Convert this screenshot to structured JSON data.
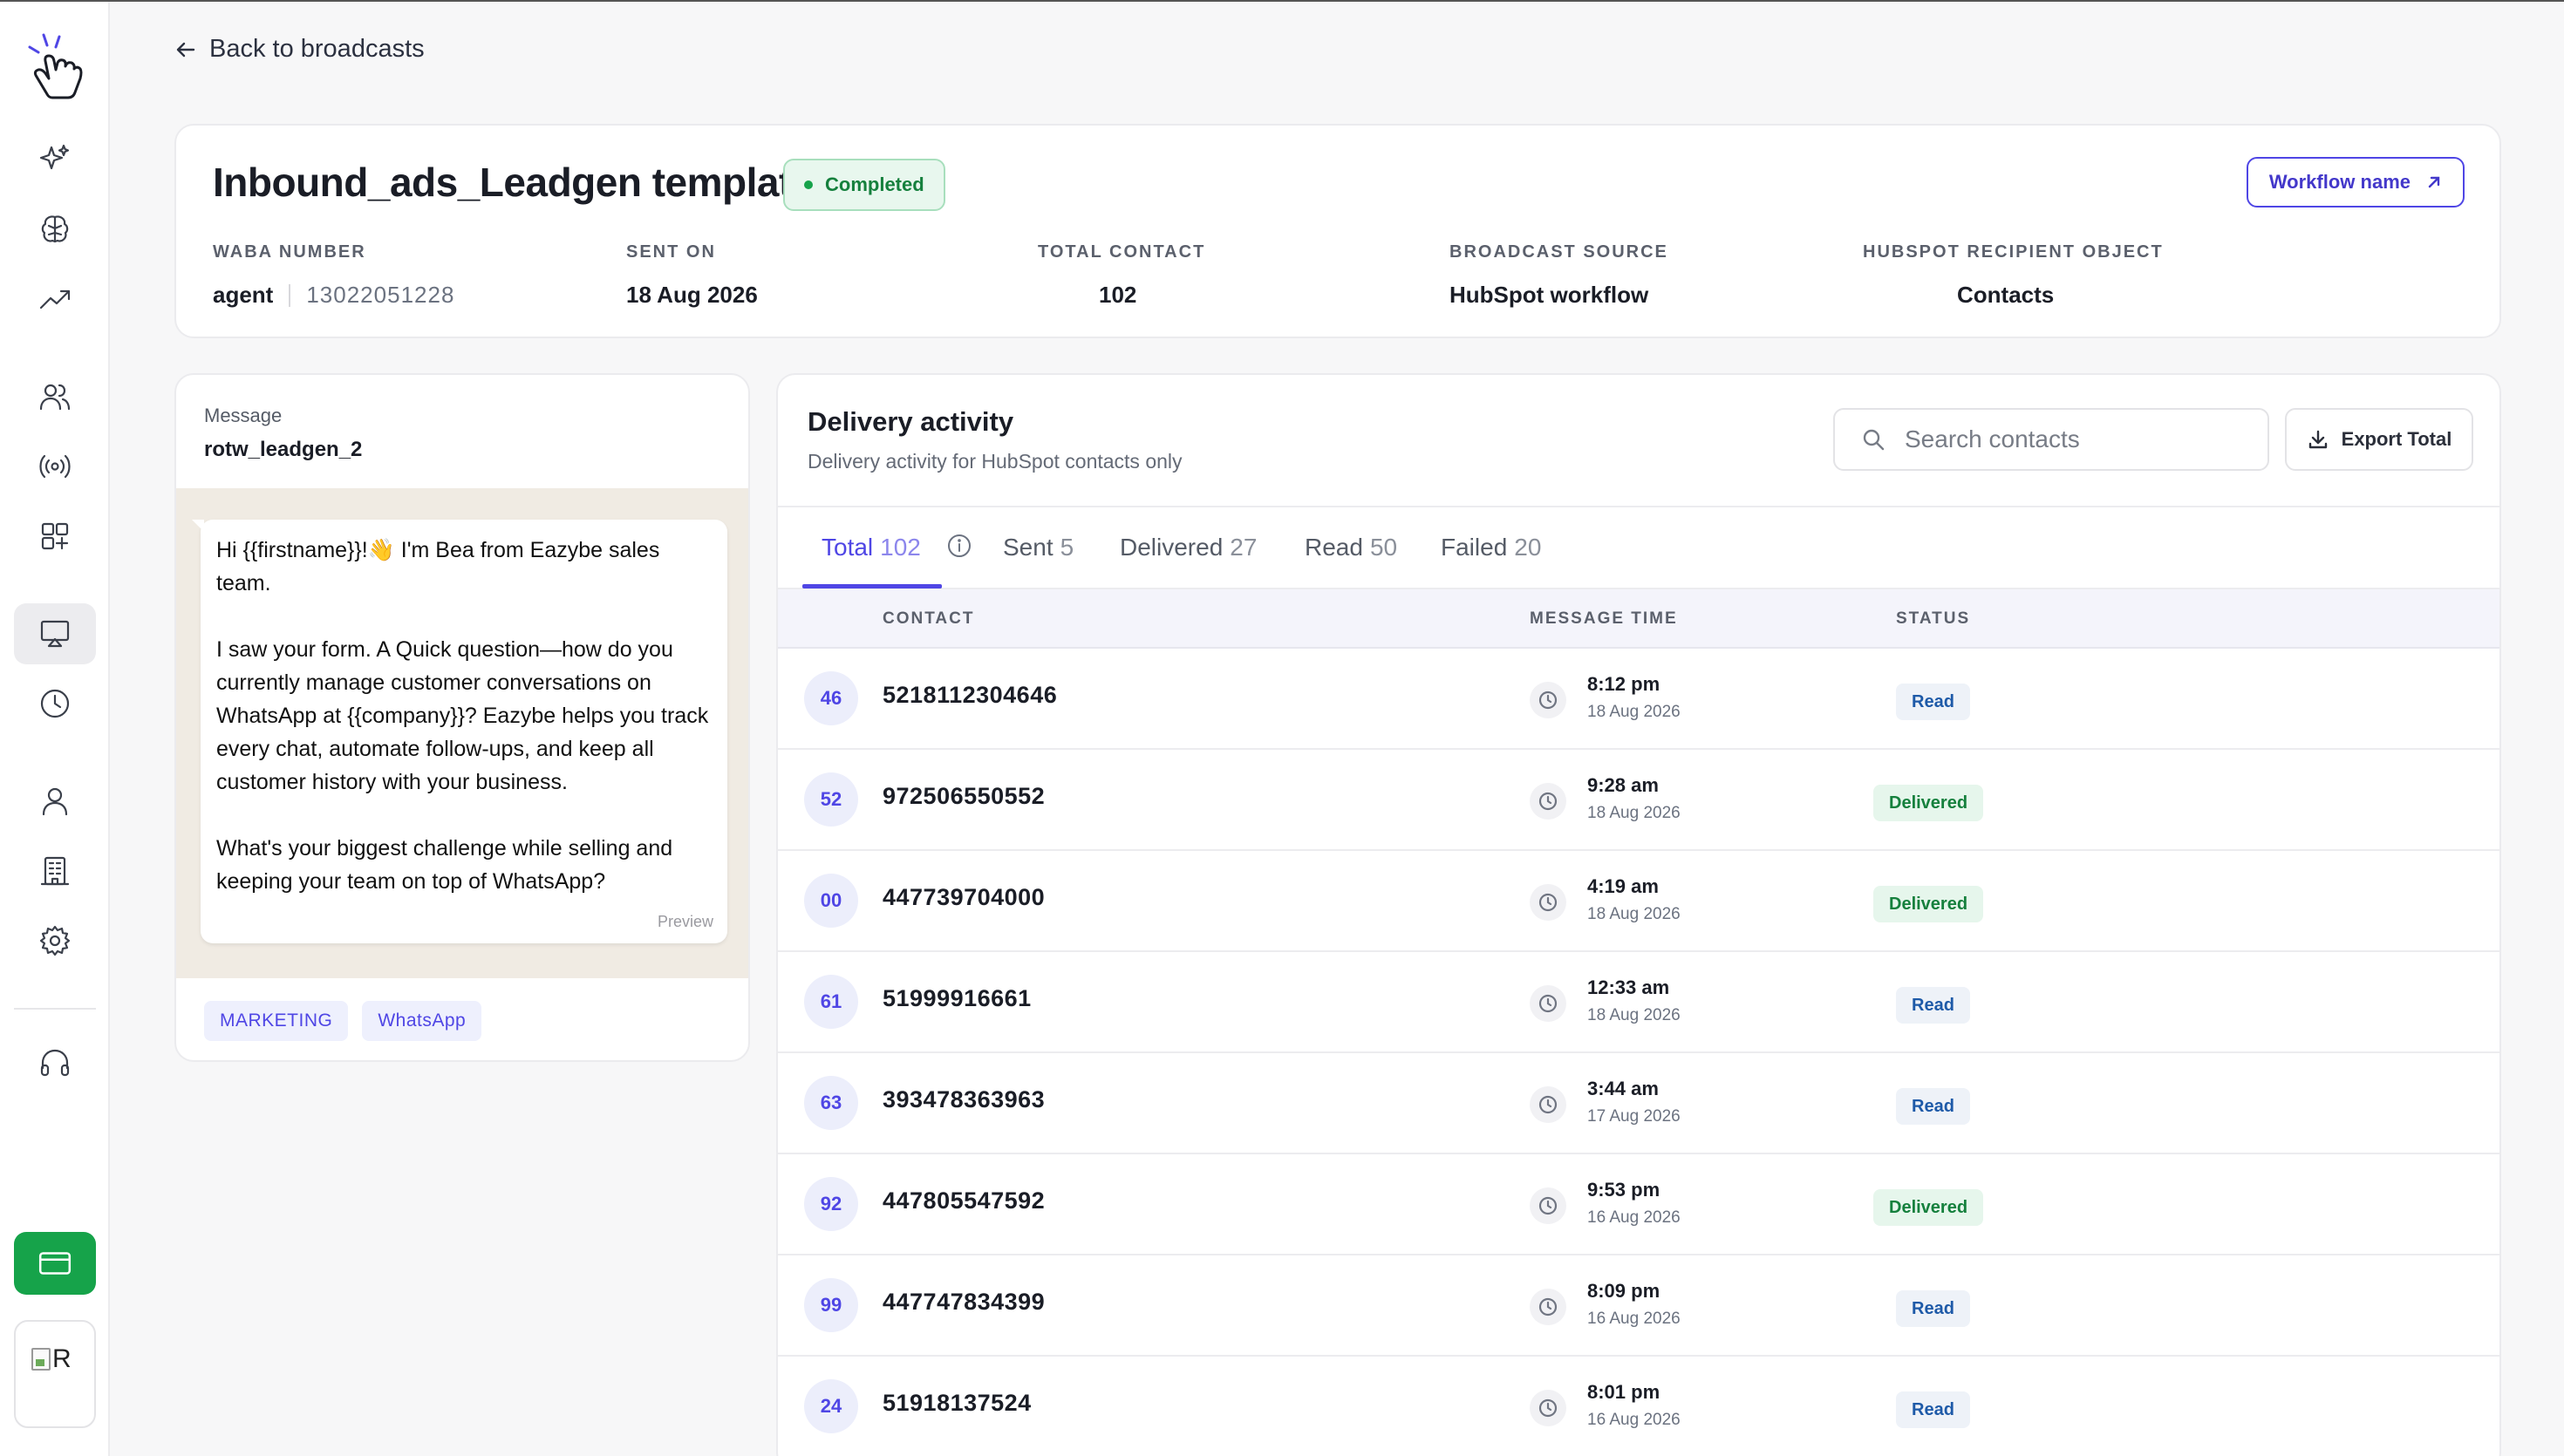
{
  "nav": {
    "back_label": "Back to broadcasts"
  },
  "header": {
    "title": "Inbound_ads_Leadgen template",
    "status": "Completed",
    "workflow_button": "Workflow name",
    "meta": {
      "waba_label": "WABA NUMBER",
      "waba_agent": "agent",
      "waba_number": "13022051228",
      "sent_on_label": "SENT ON",
      "sent_on_value": "18 Aug 2026",
      "total_contact_label": "TOTAL CONTACT",
      "total_contact_value": "102",
      "source_label": "BROADCAST SOURCE",
      "source_value": "HubSpot workflow",
      "recipient_label": "HUBSPOT RECIPIENT OBJECT",
      "recipient_value": "Contacts"
    }
  },
  "message": {
    "label": "Message",
    "name": "rotw_leadgen_2",
    "paragraphs": [
      "Hi {{firstname}}!👋 I'm Bea from Eazybe sales team.",
      "I saw your form. A Quick question—how do you currently manage customer conversations on WhatsApp at {{company}}? Eazybe helps you track every chat, automate follow-ups, and keep all customer history with your business.",
      "What's your biggest challenge while selling and keeping your team on top of WhatsApp?"
    ],
    "preview_label": "Preview",
    "tags": [
      "MARKETING",
      "WhatsApp"
    ]
  },
  "delivery": {
    "title": "Delivery activity",
    "subtitle": "Delivery activity for HubSpot contacts only",
    "search_placeholder": "Search contacts",
    "export_label": "Export Total",
    "tabs": [
      {
        "label": "Total",
        "count": "102"
      },
      {
        "label": "Sent",
        "count": "5"
      },
      {
        "label": "Delivered",
        "count": "27"
      },
      {
        "label": "Read",
        "count": "50"
      },
      {
        "label": "Failed",
        "count": "20"
      }
    ],
    "columns": [
      "CONTACT",
      "MESSAGE TIME",
      "STATUS"
    ],
    "rows": [
      {
        "badge": "46",
        "contact": "5218112304646",
        "time": "8:12 pm",
        "date": "18 Aug 2026",
        "status": "Read"
      },
      {
        "badge": "52",
        "contact": "972506550552",
        "time": "9:28 am",
        "date": "18 Aug 2026",
        "status": "Delivered"
      },
      {
        "badge": "00",
        "contact": "447739704000",
        "time": "4:19 am",
        "date": "18 Aug 2026",
        "status": "Delivered"
      },
      {
        "badge": "61",
        "contact": "51999916661",
        "time": "12:33 am",
        "date": "18 Aug 2026",
        "status": "Read"
      },
      {
        "badge": "63",
        "contact": "393478363963",
        "time": "3:44 am",
        "date": "17 Aug 2026",
        "status": "Read"
      },
      {
        "badge": "92",
        "contact": "447805547592",
        "time": "9:53 pm",
        "date": "16 Aug 2026",
        "status": "Delivered"
      },
      {
        "badge": "99",
        "contact": "447747834399",
        "time": "8:09 pm",
        "date": "16 Aug 2026",
        "status": "Read"
      },
      {
        "badge": "24",
        "contact": "51918137524",
        "time": "8:01 pm",
        "date": "16 Aug 2026",
        "status": "Read"
      }
    ]
  },
  "user": {
    "avatar_alt": "R"
  },
  "colors": {
    "accent": "#4f46e5",
    "success": "#16a34a",
    "read_text": "#1e5aa8"
  }
}
